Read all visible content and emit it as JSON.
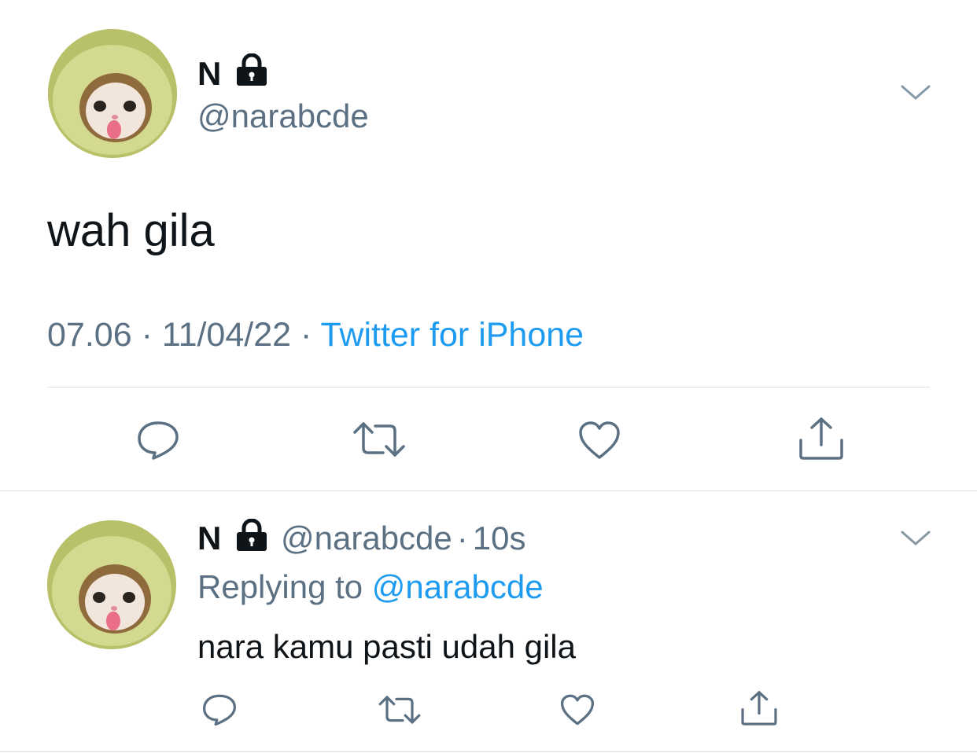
{
  "main_tweet": {
    "display_name": "N",
    "handle": "@narabcde",
    "text": "wah gila",
    "time": "07.06",
    "date": "11/04/22",
    "separator": "·",
    "source": "Twitter for iPhone",
    "actions": [
      "reply",
      "retweet",
      "like",
      "share"
    ]
  },
  "reply_tweet": {
    "display_name": "N",
    "handle": "@narabcde",
    "separator": "·",
    "elapsed": "10s",
    "replying_label": "Replying to",
    "replying_handle": "@narabcde",
    "text": "nara kamu pasti udah gila",
    "actions": [
      "reply",
      "retweet",
      "like",
      "share"
    ]
  },
  "icons": {
    "lock": "lock-icon",
    "more": "chevron-down-icon",
    "reply": "reply-icon",
    "retweet": "retweet-icon",
    "like": "heart-icon",
    "share": "share-icon"
  },
  "colors": {
    "text": "#0f1419",
    "muted": "#5b7083",
    "link": "#1d9bf0",
    "divider": "#dcdfe3"
  }
}
